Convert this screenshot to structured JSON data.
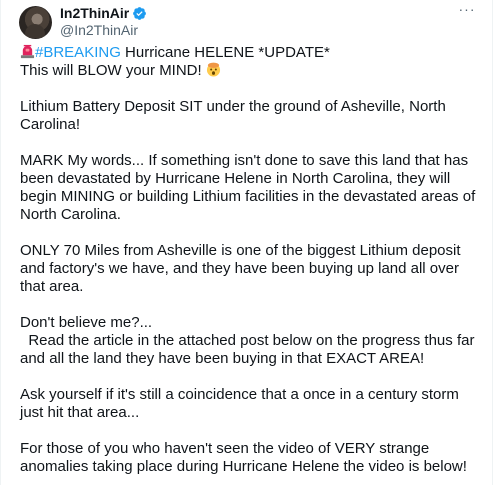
{
  "author": {
    "display_name": "In2ThinAir",
    "handle": "@In2ThinAir",
    "verified_badge_color": "#1d9bf0",
    "avatar_icon": "avatar"
  },
  "menu": {
    "more_label": "···"
  },
  "tweet": {
    "line1_emoji": "rotating-light-icon",
    "hashtag": "#BREAKING",
    "line1_rest": " Hurricane HELENE *UPDATE*",
    "line2": "This will BLOW your MIND! ",
    "line2_emoji": "shocked-face-icon",
    "para2": "Lithium Battery Deposit SIT under the ground of Asheville, North Carolina!",
    "para3": "MARK My words... If something isn't done to save this land that has been devastated by Hurricane Helene in North Carolina, they will begin MINING or building Lithium facilities in the devastated areas of North Carolina.",
    "para4": "ONLY 70 Miles from Asheville is one of the biggest Lithium deposit and factory's we have, and they have been buying up land all over that area.",
    "para5_line1": "Don't believe me?...",
    "para5_rest": "  Read the article in the attached post below on the progress thus far and all the land they have been buying in that EXACT AREA!",
    "para6": "Ask yourself if it's still a coincidence that a once in a century storm just hit that area...",
    "para7": "For those of you who haven't seen the video of VERY strange anomalies taking place during Hurricane Helene the video is below!"
  },
  "colors": {
    "text": "#0f1419",
    "secondary": "#536471",
    "link": "#1d9bf0"
  }
}
